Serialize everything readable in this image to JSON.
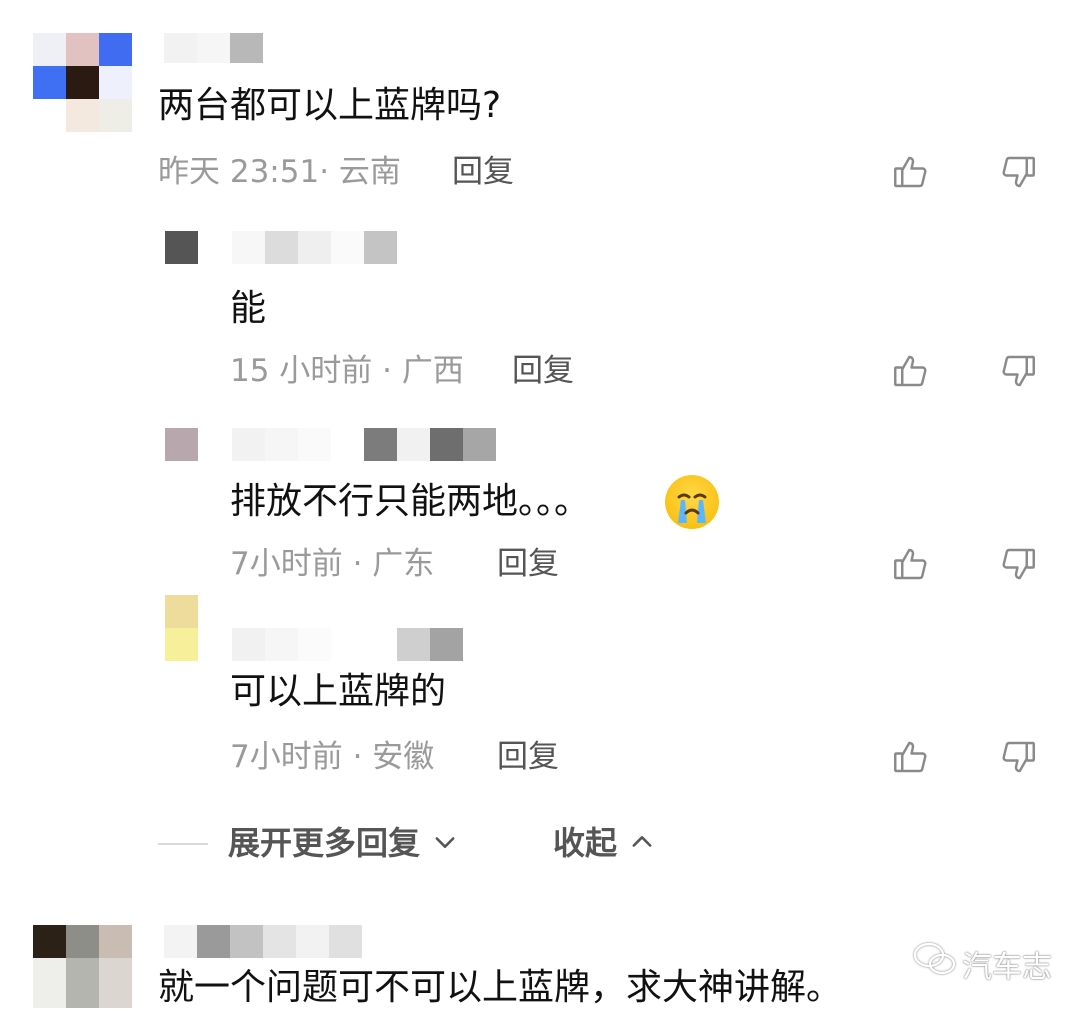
{
  "comments": [
    {
      "content": "两台都可以上蓝牌吗?",
      "meta": "昨天 23:51· 云南",
      "reply_label": "回复"
    },
    {
      "content": "能",
      "meta": "15 小时前 · 广西",
      "reply_label": "回复"
    },
    {
      "content": "排放不行只能两地。。。",
      "meta": "7小时前 · 广东",
      "reply_label": "回复"
    },
    {
      "content": "可以上蓝牌的",
      "meta": "7小时前 · 安徽",
      "reply_label": "回复"
    },
    {
      "content": "就一个问题可不可以上蓝牌，求大神讲解。"
    }
  ],
  "thread_controls": {
    "expand_label": "展开更多回复",
    "collapse_label": "收起"
  },
  "watermark": {
    "text": "汽车志"
  },
  "icons": {
    "like": "thumbs-up-icon",
    "dislike": "thumbs-down-icon",
    "expand": "chevron-down-icon",
    "collapse": "chevron-up-icon",
    "emoji": "crying-face-emoji",
    "wechat": "wechat-logo-icon"
  },
  "colors": {
    "text": "#111111",
    "meta": "#9a9a9a",
    "reply": "#555555",
    "divider": "#d9d9d9"
  }
}
